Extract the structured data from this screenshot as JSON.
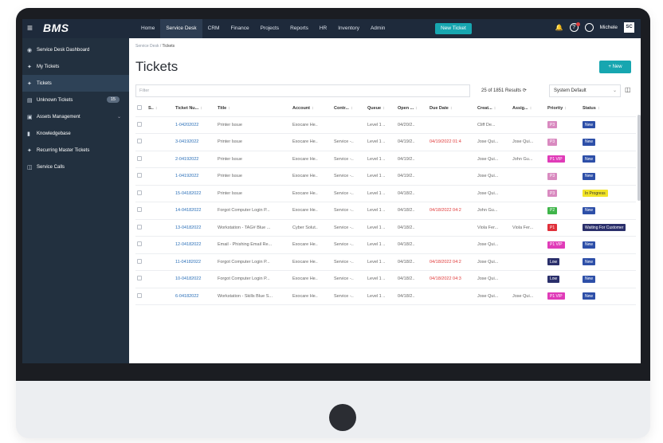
{
  "app": {
    "logo": "BMS",
    "menu_icon": "hamburger-icon"
  },
  "nav": {
    "items": [
      "Home",
      "Service Desk",
      "CRM",
      "Finance",
      "Projects",
      "Reports",
      "HR",
      "Inventory",
      "Admin"
    ],
    "new_ticket": "New Ticket"
  },
  "user": {
    "name": "Michele",
    "initials": "SC",
    "help_glyph": "?"
  },
  "sidebar": {
    "items": [
      {
        "label": "Service Desk Dashboard",
        "icon": "dashboard-icon"
      },
      {
        "label": "My Tickets",
        "icon": "pin-icon"
      },
      {
        "label": "Tickets",
        "icon": "pin-icon"
      },
      {
        "label": "Unknown Tickets",
        "icon": "inbox-icon",
        "count": "15"
      },
      {
        "label": "Assets Management",
        "icon": "assets-icon"
      },
      {
        "label": "Knowledgebase",
        "icon": "book-icon"
      },
      {
        "label": "Recurring Master Tickets",
        "icon": "pin-icon"
      },
      {
        "label": "Service Calls",
        "icon": "calls-icon"
      }
    ]
  },
  "breadcrumb": {
    "parent": "Service Desk",
    "sep": " / ",
    "current": "Tickets"
  },
  "page": {
    "title": "Tickets",
    "new_button": "+ New",
    "filter_placeholder": "Filter",
    "results": "25 of 1851 Results",
    "view": "System Default"
  },
  "table": {
    "headers": [
      "S..",
      "Ticket Nu...",
      "Title",
      "Account",
      "Contr...",
      "Queue",
      "Open ...",
      "Due Date",
      "Creat...",
      "Assig...",
      "Priority",
      "Status"
    ],
    "rows": [
      {
        "num": "1-04202022",
        "title": "Printer Issue",
        "account": "Exocare He..",
        "contract": "",
        "queue": "Level 1 ..",
        "open": "04/20/2..",
        "due": "",
        "due_red": false,
        "created": "Cliff De...",
        "assigned": "",
        "priority": "P3",
        "pcolor": "#d98ac0",
        "status": "New",
        "scolor": "#2d4fa8",
        "stext": "#ffffff"
      },
      {
        "num": "3-04192022",
        "title": "Printer Issue",
        "account": "Exocare He..",
        "contract": "Service -..",
        "queue": "Level 1 ..",
        "open": "04/19/2..",
        "due": "04/19/2022 01:4",
        "due_red": true,
        "created": "Jose Qui...",
        "assigned": "Jose Qui...",
        "priority": "P3",
        "pcolor": "#d98ac0",
        "status": "New",
        "scolor": "#2d4fa8",
        "stext": "#ffffff"
      },
      {
        "num": "2-04192022",
        "title": "Printer Issue",
        "account": "Exocare He..",
        "contract": "Service -..",
        "queue": "Level 1 ..",
        "open": "04/19/2..",
        "due": "",
        "due_red": false,
        "created": "Jose Qui...",
        "assigned": "John Gu...",
        "priority": "P1 VIP",
        "pcolor": "#e03bb8",
        "status": "New",
        "scolor": "#2d4fa8",
        "stext": "#ffffff"
      },
      {
        "num": "1-04192022",
        "title": "Printer Issue",
        "account": "Exocare He..",
        "contract": "Service -..",
        "queue": "Level 1 ..",
        "open": "04/19/2..",
        "due": "",
        "due_red": false,
        "created": "Jose Qui...",
        "assigned": "",
        "priority": "P3",
        "pcolor": "#d98ac0",
        "status": "New",
        "scolor": "#2d4fa8",
        "stext": "#ffffff"
      },
      {
        "num": "15-04182022",
        "title": "Printer Issue",
        "account": "Exocare He..",
        "contract": "Service -..",
        "queue": "Level 1 ..",
        "open": "04/18/2..",
        "due": "",
        "due_red": false,
        "created": "Jose Qui...",
        "assigned": "",
        "priority": "P3",
        "pcolor": "#d98ac0",
        "status": "In Progress",
        "scolor": "#f2e427",
        "stext": "#333333"
      },
      {
        "num": "14-04182022",
        "title": "Forgot Computer Login P...",
        "account": "Exocare He..",
        "contract": "Service -..",
        "queue": "Level 1 ..",
        "open": "04/18/2..",
        "due": "04/18/2022 04:2",
        "due_red": true,
        "created": "John Gu...",
        "assigned": "",
        "priority": "P2",
        "pcolor": "#3fb54a",
        "status": "New",
        "scolor": "#2d4fa8",
        "stext": "#ffffff"
      },
      {
        "num": "13-04182022",
        "title": "Workstation - TAG# Blue ...",
        "account": "Cyber Solut..",
        "contract": "Service -..",
        "queue": "Level 1 ..",
        "open": "04/18/2..",
        "due": "",
        "due_red": false,
        "created": "Viola Fer...",
        "assigned": "Viola Fer...",
        "priority": "P1",
        "pcolor": "#e0303a",
        "status": "Waiting For Customer",
        "scolor": "#2a2f6b",
        "stext": "#ffffff"
      },
      {
        "num": "12-04182022",
        "title": "Email - Phishing Email Re...",
        "account": "Exocare He..",
        "contract": "Service -..",
        "queue": "Level 1 ..",
        "open": "04/18/2..",
        "due": "",
        "due_red": false,
        "created": "Jose Qui...",
        "assigned": "",
        "priority": "P1 VIP",
        "pcolor": "#e03bb8",
        "status": "New",
        "scolor": "#2d4fa8",
        "stext": "#ffffff"
      },
      {
        "num": "11-04182022",
        "title": "Forgot Computer Login P...",
        "account": "Exocare He..",
        "contract": "Service -..",
        "queue": "Level 1 ..",
        "open": "04/18/2..",
        "due": "04/18/2022 04:2",
        "due_red": true,
        "created": "Jose Qui...",
        "assigned": "",
        "priority": "Low",
        "pcolor": "#2a2f6b",
        "status": "New",
        "scolor": "#2d4fa8",
        "stext": "#ffffff"
      },
      {
        "num": "10-04182022",
        "title": "Forgot Computer Login P...",
        "account": "Exocare He..",
        "contract": "Service -..",
        "queue": "Level 1 ..",
        "open": "04/18/2..",
        "due": "04/18/2022 04:3",
        "due_red": true,
        "created": "Jose Qui...",
        "assigned": "",
        "priority": "Low",
        "pcolor": "#2a2f6b",
        "status": "New",
        "scolor": "#2d4fa8",
        "stext": "#ffffff"
      },
      {
        "num": "6-04182022",
        "title": "Workstation - Skills Blue S...",
        "account": "Exocare He..",
        "contract": "Service -..",
        "queue": "Level 1 ..",
        "open": "04/18/2..",
        "due": "",
        "due_red": false,
        "created": "Jose Qui...",
        "assigned": "Jose Qui...",
        "priority": "P1 VIP",
        "pcolor": "#e03bb8",
        "status": "New",
        "scolor": "#2d4fa8",
        "stext": "#ffffff"
      }
    ]
  }
}
